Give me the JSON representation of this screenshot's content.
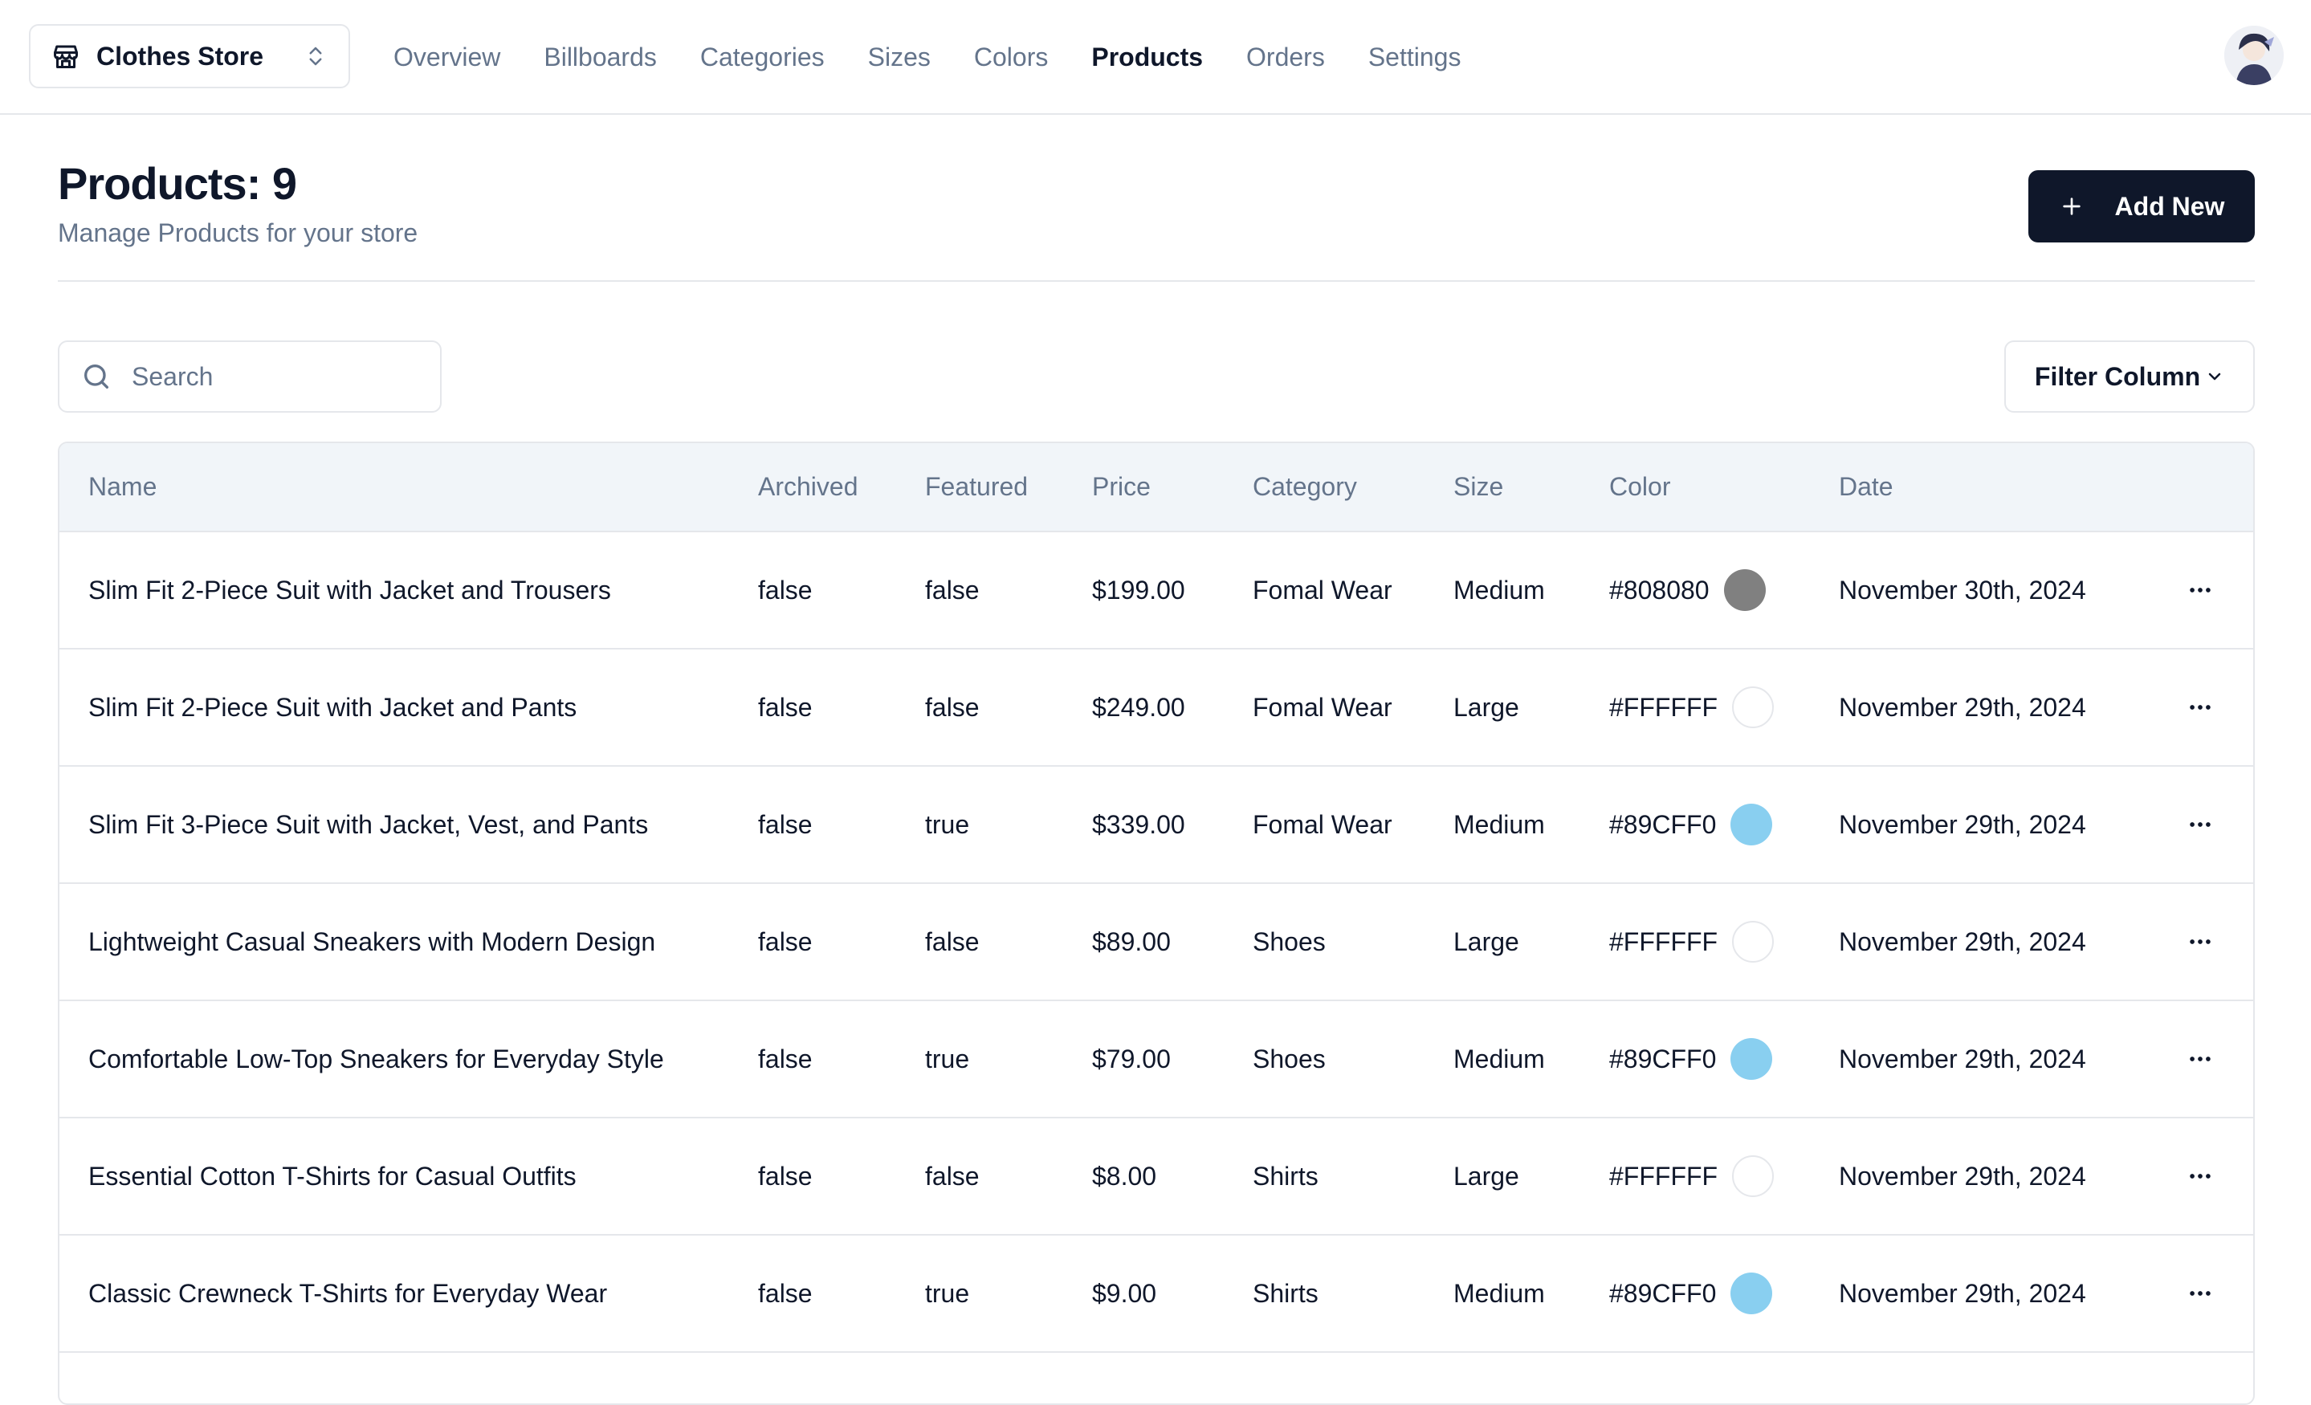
{
  "store": {
    "name": "Clothes Store"
  },
  "nav": {
    "items": [
      {
        "label": "Overview",
        "active": false
      },
      {
        "label": "Billboards",
        "active": false
      },
      {
        "label": "Categories",
        "active": false
      },
      {
        "label": "Sizes",
        "active": false
      },
      {
        "label": "Colors",
        "active": false
      },
      {
        "label": "Products",
        "active": true
      },
      {
        "label": "Orders",
        "active": false
      },
      {
        "label": "Settings",
        "active": false
      }
    ]
  },
  "header": {
    "title": "Products: 9",
    "subtitle": "Manage Products for your store",
    "add_label": "Add New"
  },
  "toolbar": {
    "search_placeholder": "Search",
    "filter_label": "Filter Column"
  },
  "table": {
    "columns": [
      "Name",
      "Archived",
      "Featured",
      "Price",
      "Category",
      "Size",
      "Color",
      "Date"
    ],
    "rows": [
      {
        "name": "Slim Fit 2-Piece Suit with Jacket and Trousers",
        "archived": "false",
        "featured": "false",
        "price": "$199.00",
        "category": "Fomal Wear",
        "size": "Medium",
        "color": "#808080",
        "date": "November 30th, 2024"
      },
      {
        "name": "Slim Fit 2-Piece Suit with Jacket and Pants",
        "archived": "false",
        "featured": "false",
        "price": "$249.00",
        "category": "Fomal Wear",
        "size": "Large",
        "color": "#FFFFFF",
        "date": "November 29th, 2024"
      },
      {
        "name": "Slim Fit 3-Piece Suit with Jacket, Vest, and Pants",
        "archived": "false",
        "featured": "true",
        "price": "$339.00",
        "category": "Fomal Wear",
        "size": "Medium",
        "color": "#89CFF0",
        "date": "November 29th, 2024"
      },
      {
        "name": "Lightweight Casual Sneakers with Modern Design",
        "archived": "false",
        "featured": "false",
        "price": "$89.00",
        "category": "Shoes",
        "size": "Large",
        "color": "#FFFFFF",
        "date": "November 29th, 2024"
      },
      {
        "name": "Comfortable Low-Top Sneakers for Everyday Style",
        "archived": "false",
        "featured": "true",
        "price": "$79.00",
        "category": "Shoes",
        "size": "Medium",
        "color": "#89CFF0",
        "date": "November 29th, 2024"
      },
      {
        "name": "Essential Cotton T-Shirts for Casual Outfits",
        "archived": "false",
        "featured": "false",
        "price": "$8.00",
        "category": "Shirts",
        "size": "Large",
        "color": "#FFFFFF",
        "date": "November 29th, 2024"
      },
      {
        "name": "Classic Crewneck T-Shirts for Everyday Wear",
        "archived": "false",
        "featured": "true",
        "price": "$9.00",
        "category": "Shirts",
        "size": "Medium",
        "color": "#89CFF0",
        "date": "November 29th, 2024"
      }
    ]
  },
  "colors": {
    "primary": "#0f172a",
    "muted_text": "#64748b",
    "border": "#e5e7eb",
    "header_bg": "#f1f5f9"
  }
}
